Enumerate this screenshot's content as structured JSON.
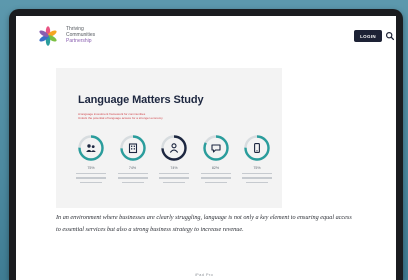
{
  "site": {
    "logo_lines": [
      "Thriving",
      "Communities",
      "Partnership"
    ],
    "login_label": "LOGIN"
  },
  "hero": {
    "title": "Language Matters Study",
    "subtitle_lines": [
      "A language investment framework for communities",
      "Unlock the potential of language access for a stronger economy"
    ]
  },
  "stats": [
    {
      "percent": "75%",
      "icon": "people-icon",
      "progress": 0.75
    },
    {
      "percent": "74%",
      "icon": "building-icon",
      "progress": 0.74
    },
    {
      "percent": "74%",
      "icon": "person-icon",
      "progress": 0.74
    },
    {
      "percent": "82%",
      "icon": "chat-icon",
      "progress": 0.82
    },
    {
      "percent": "75%",
      "icon": "phone-icon",
      "progress": 0.75
    }
  ],
  "intro_text": "In an environment where businesses are clearly struggling, language is not only a key element to ensuring equal access to essential services but also a strong business strategy to increase revenue.",
  "device_label": "iPad Pro",
  "colors": {
    "teal": "#2a9d9c",
    "navy": "#1d2740",
    "accent_red": "#d0474d",
    "login_bg": "#1d2235"
  }
}
